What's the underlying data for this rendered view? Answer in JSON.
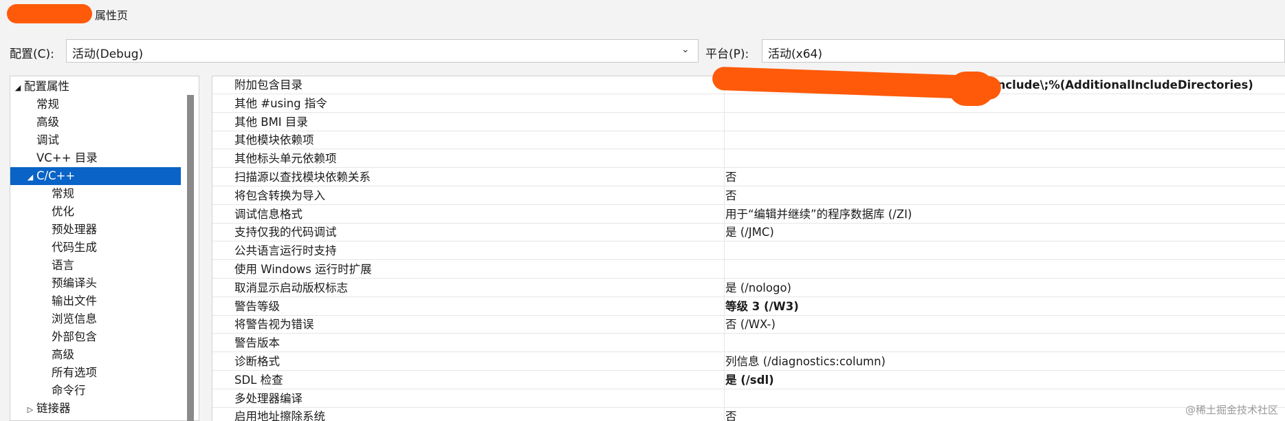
{
  "window": {
    "title_suffix": "属性页"
  },
  "config_bar": {
    "configuration_label": "配置(C):",
    "configuration_value": "活动(Debug)",
    "platform_label": "平台(P):",
    "platform_value": "活动(x64)"
  },
  "tree": {
    "items": [
      {
        "label": "配置属性",
        "caret": "◢",
        "selected": false
      },
      {
        "label": "常规",
        "caret": "",
        "selected": false
      },
      {
        "label": "高级",
        "caret": "",
        "selected": false
      },
      {
        "label": "调试",
        "caret": "",
        "selected": false
      },
      {
        "label": "VC++ 目录",
        "caret": "",
        "selected": false
      },
      {
        "label": "C/C++",
        "caret": "◢",
        "selected": true
      },
      {
        "label": "常规",
        "caret": "",
        "selected": false
      },
      {
        "label": "优化",
        "caret": "",
        "selected": false
      },
      {
        "label": "预处理器",
        "caret": "",
        "selected": false
      },
      {
        "label": "代码生成",
        "caret": "",
        "selected": false
      },
      {
        "label": "语言",
        "caret": "",
        "selected": false
      },
      {
        "label": "预编译头",
        "caret": "",
        "selected": false
      },
      {
        "label": "输出文件",
        "caret": "",
        "selected": false
      },
      {
        "label": "浏览信息",
        "caret": "",
        "selected": false
      },
      {
        "label": "外部包含",
        "caret": "",
        "selected": false
      },
      {
        "label": "高级",
        "caret": "",
        "selected": false
      },
      {
        "label": "所有选项",
        "caret": "",
        "selected": false
      },
      {
        "label": "命令行",
        "caret": "",
        "selected": false
      },
      {
        "label": "链接器",
        "caret": "▷",
        "selected": false
      }
    ]
  },
  "properties": {
    "rows": [
      {
        "name": "附加包含目录",
        "value": "include\\;%(AdditionalIncludeDirectories)",
        "bold": true
      },
      {
        "name": "其他 #using 指令",
        "value": "",
        "bold": false
      },
      {
        "name": "其他 BMI 目录",
        "value": "",
        "bold": false
      },
      {
        "name": "其他模块依赖项",
        "value": "",
        "bold": false
      },
      {
        "name": "其他标头单元依赖项",
        "value": "",
        "bold": false
      },
      {
        "name": "扫描源以查找模块依赖关系",
        "value": "否",
        "bold": false
      },
      {
        "name": "将包含转换为导入",
        "value": "否",
        "bold": false
      },
      {
        "name": "调试信息格式",
        "value": "用于“编辑并继续”的程序数据库 (/ZI)",
        "bold": false
      },
      {
        "name": "支持仅我的代码调试",
        "value": "是 (/JMC)",
        "bold": false
      },
      {
        "name": "公共语言运行时支持",
        "value": "",
        "bold": false
      },
      {
        "name": "使用 Windows 运行时扩展",
        "value": "",
        "bold": false
      },
      {
        "name": "取消显示启动版权标志",
        "value": "是 (/nologo)",
        "bold": false
      },
      {
        "name": "警告等级",
        "value": "等级 3 (/W3)",
        "bold": true
      },
      {
        "name": "将警告视为错误",
        "value": "否 (/WX-)",
        "bold": false
      },
      {
        "name": "警告版本",
        "value": "",
        "bold": false
      },
      {
        "name": "诊断格式",
        "value": "列信息 (/diagnostics:column)",
        "bold": false
      },
      {
        "name": "SDL 检查",
        "value": "是 (/sdl)",
        "bold": true
      },
      {
        "name": "多处理器编译",
        "value": "",
        "bold": false
      },
      {
        "name": "启用地址擦除系统",
        "value": "否",
        "bold": false
      }
    ]
  },
  "watermark": "@稀土掘金技术社区",
  "colors": {
    "selection": "#0a63c6",
    "redaction": "#ff5a0a"
  },
  "icons": {
    "combo_arrow": "chevron-down-icon"
  }
}
